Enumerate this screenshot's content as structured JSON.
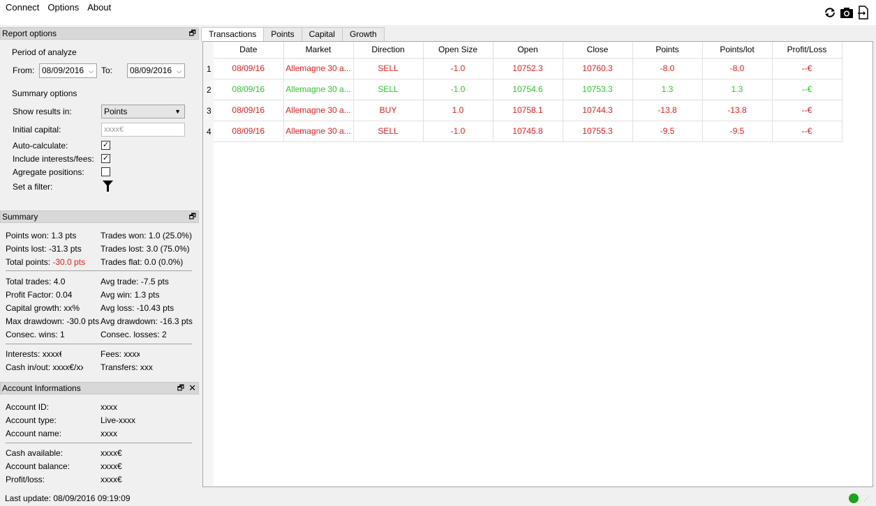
{
  "menu": {
    "connect": "Connect",
    "options": "Options",
    "about": "About"
  },
  "toolbar": {
    "icons": [
      "refresh-icon",
      "camera-icon",
      "export-icon"
    ]
  },
  "report_options": {
    "title": "Report options",
    "period_label": "Period of analyze",
    "from_label": "From:",
    "from_value": "08/09/2016",
    "to_label": "To:",
    "to_value": "08/09/2016",
    "summary_options_label": "Summary options",
    "show_results_label": "Show results in:",
    "show_results_value": "Points",
    "initial_capital_label": "Initial capital:",
    "initial_capital_placeholder": "xxxx€",
    "auto_calc_label": "Auto-calculate:",
    "include_fees_label": "Include interests/fees:",
    "aggregate_label": "Agregate positions:",
    "filter_label": "Set a filter:"
  },
  "summary": {
    "title": "Summary",
    "points_won": "Points won: 1.3 pts",
    "points_lost": "Points lost: -31.3 pts",
    "total_points_label": "Total points: ",
    "total_points_value": "-30.0 pts",
    "trades_won": "Trades won: 1.0 (25.0%)",
    "trades_lost": "Trades lost: 3.0 (75.0%)",
    "trades_flat": "Trades flat: 0.0 (0.0%)",
    "total_trades": "Total trades: 4.0",
    "profit_factor": "Profit Factor: 0.04",
    "capital_growth": "Capital growth: xx%",
    "max_drawdown": "Max drawdown: -30.0 pts",
    "consec_wins": "Consec. wins: 1",
    "avg_trade": "Avg trade: -7.5 pts",
    "avg_win": "Avg win: 1.3 pts",
    "avg_loss": "Avg loss: -10.43 pts",
    "avg_drawdown": "Avg drawdown: -16.3 pts",
    "consec_losses": "Consec. losses: 2",
    "interests": "Interests: xxxx€",
    "fees": "Fees: xxxx€",
    "cash_inout": "Cash in/out: xxxx€/xxx",
    "transfers": "Transfers: xxxx"
  },
  "account": {
    "title": "Account Informations",
    "id_label": "Account ID:",
    "id_value": "xxxx",
    "type_label": "Account type:",
    "type_value": "Live-xxxx",
    "name_label": "Account name:",
    "name_value": "xxxx",
    "cash_label": "Cash available:",
    "cash_value": "xxxx€",
    "balance_label": "Account balance:",
    "balance_value": "xxxx€",
    "pl_label": "Profit/loss:",
    "pl_value": "xxxx€"
  },
  "tabs": [
    "Transactions",
    "Points",
    "Capital",
    "Growth"
  ],
  "table": {
    "headers": [
      "Date",
      "Market",
      "Direction",
      "Open Size",
      "Open",
      "Close",
      "Points",
      "Points/lot",
      "Profit/Loss"
    ],
    "rows": [
      {
        "num": "1",
        "status": "loss",
        "cells": [
          "08/09/16",
          "Allemagne 30 a...",
          "SELL",
          "-1.0",
          "10752.3",
          "10760.3",
          "-8.0",
          "-8.0",
          "--€"
        ]
      },
      {
        "num": "2",
        "status": "win",
        "cells": [
          "08/09/16",
          "Allemagne 30 a...",
          "SELL",
          "-1.0",
          "10754.6",
          "10753.3",
          "1.3",
          "1.3",
          "--€"
        ]
      },
      {
        "num": "3",
        "status": "loss",
        "cells": [
          "08/09/16",
          "Allemagne 30 a...",
          "BUY",
          "1.0",
          "10758.1",
          "10744.3",
          "-13.8",
          "-13.8",
          "--€"
        ]
      },
      {
        "num": "4",
        "status": "loss",
        "cells": [
          "08/09/16",
          "Allemagne 30 a...",
          "SELL",
          "-1.0",
          "10745.8",
          "10755.3",
          "-9.5",
          "-9.5",
          "--€"
        ]
      }
    ]
  },
  "status": {
    "last_update": "Last update: 08/09/2016 09:19:09",
    "connection_color": "#1aa51a"
  }
}
